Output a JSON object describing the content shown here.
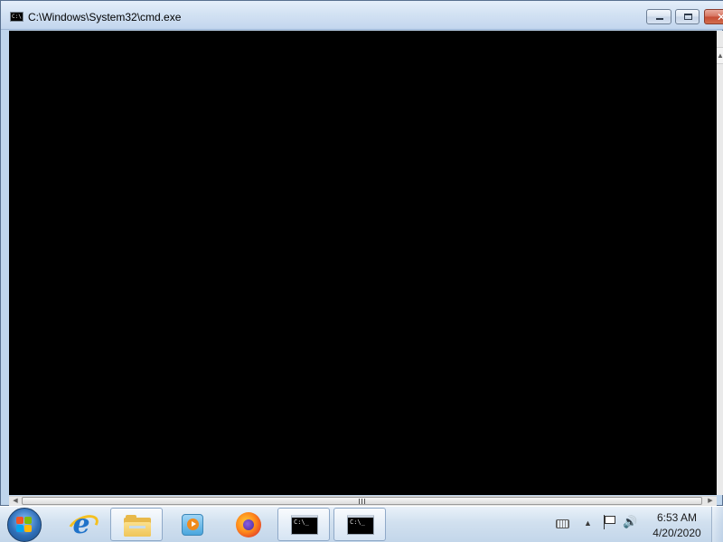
{
  "window": {
    "title": "C:\\Windows\\System32\\cmd.exe",
    "icon": "console-icon",
    "icon_text": "C:\\",
    "buttons": {
      "minimize": "minimize-icon",
      "maximize": "maximize-icon",
      "close": "close-icon"
    }
  },
  "console": {
    "text": ""
  },
  "scrollbars": {
    "vertical_up": "▲",
    "left_arrow": "◀",
    "right_arrow": "▶"
  },
  "taskbar": {
    "start": "windows-start-icon",
    "items": [
      {
        "icon": "internet-explorer-icon",
        "glyph": "e",
        "active": false
      },
      {
        "icon": "windows-explorer-icon",
        "active": true
      },
      {
        "icon": "media-player-icon",
        "active": false
      },
      {
        "icon": "firefox-icon",
        "active": false
      },
      {
        "icon": "command-prompt-icon",
        "glyph": "C:\\_",
        "active": true
      },
      {
        "icon": "command-prompt-icon",
        "glyph": "C:\\_",
        "active": true
      }
    ],
    "tray": {
      "keyboard": "keyboard-icon",
      "show_hidden": "▲",
      "action_center": "action-center-flag-icon",
      "volume": "🔊",
      "time": "6:53 AM",
      "date": "4/20/2020"
    }
  }
}
